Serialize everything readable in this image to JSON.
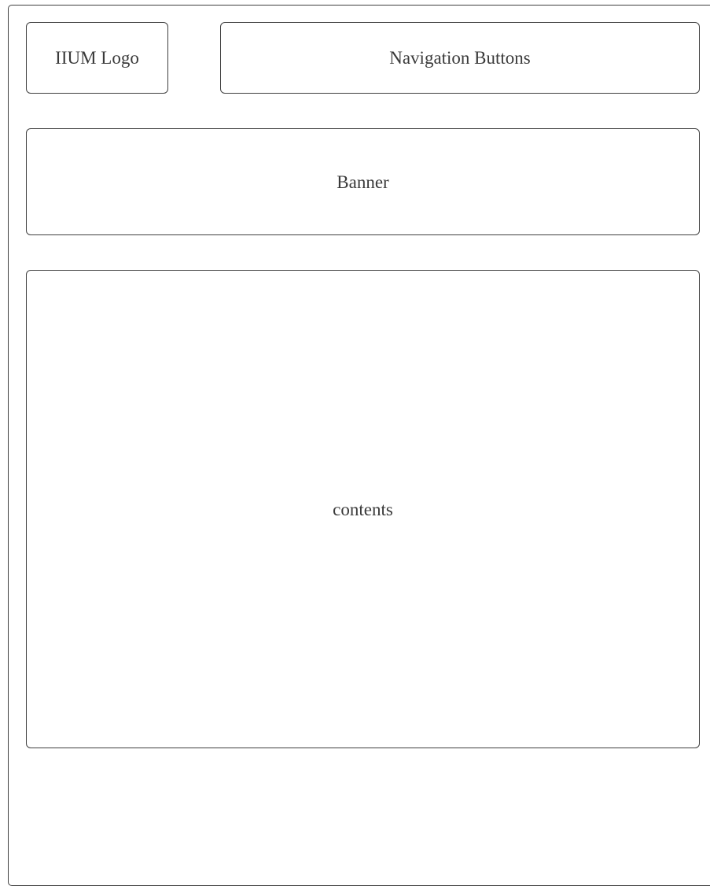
{
  "wireframe": {
    "logo_label": "IIUM Logo",
    "navigation_label": "Navigation Buttons",
    "banner_label": "Banner",
    "contents_label": "contents"
  }
}
